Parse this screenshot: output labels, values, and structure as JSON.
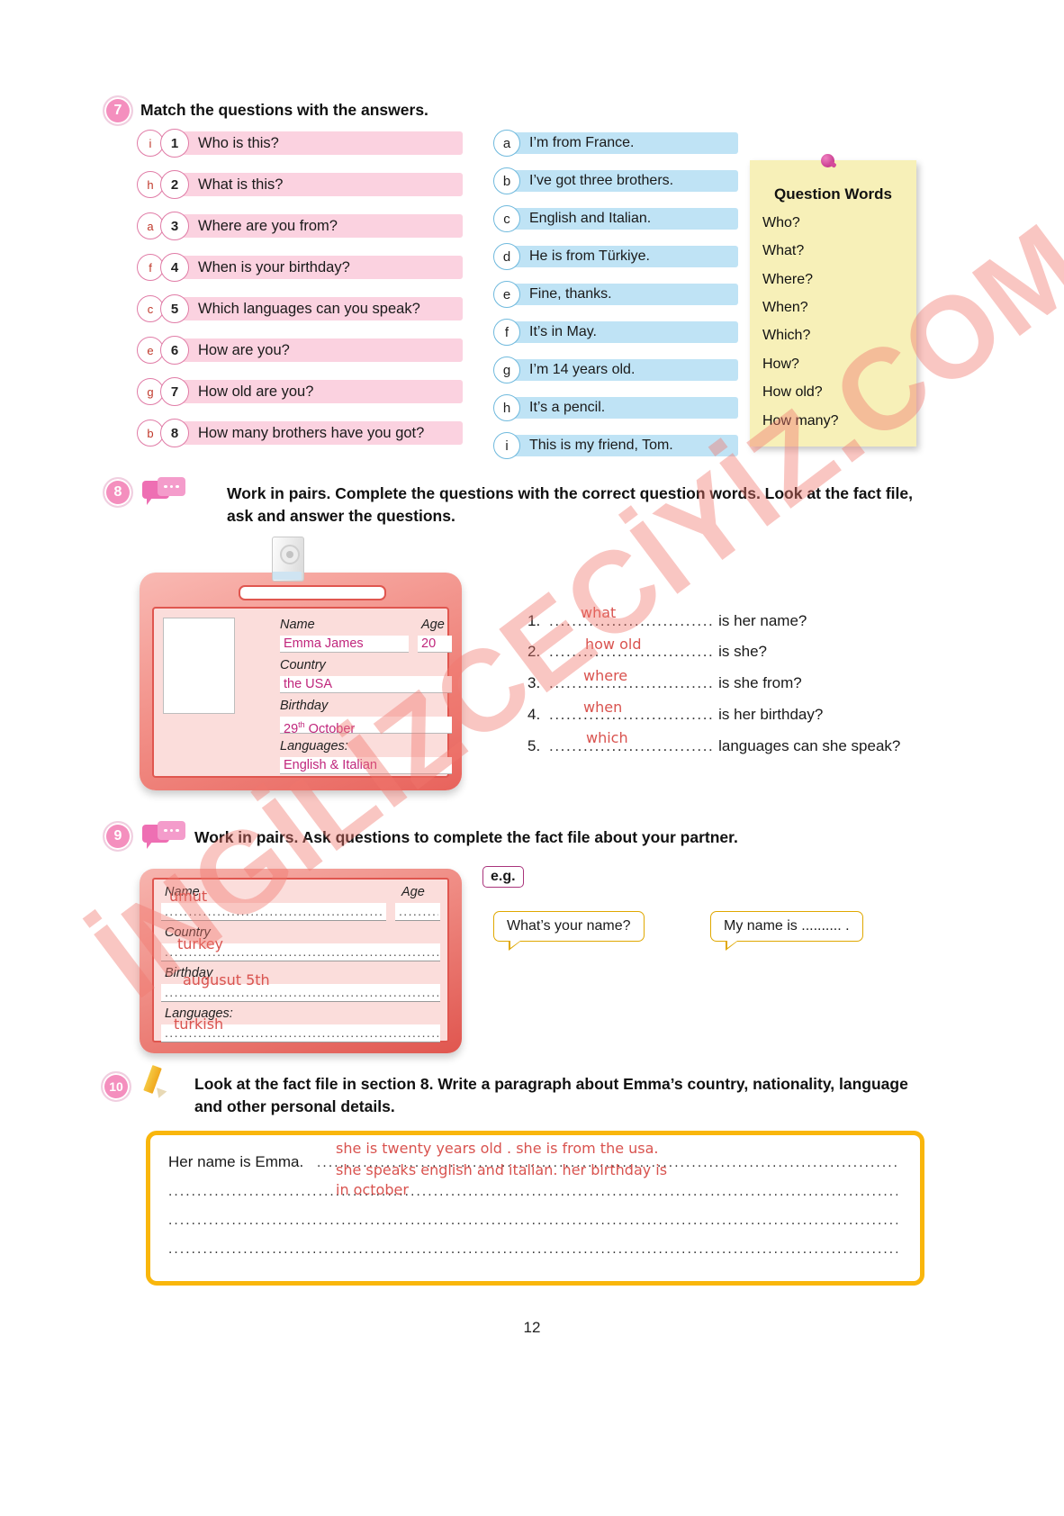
{
  "watermark": "İNGİLİZCECİYİZ.COM",
  "page_number": "12",
  "exercise7": {
    "number": "7",
    "instruction": "Match the questions with the answers.",
    "questions": [
      {
        "answer": "i",
        "num": "1",
        "text": "Who is this?"
      },
      {
        "answer": "h",
        "num": "2",
        "text": "What is this?"
      },
      {
        "answer": "a",
        "num": "3",
        "text": "Where are you from?"
      },
      {
        "answer": "f",
        "num": "4",
        "text": "When is your birthday?"
      },
      {
        "answer": "c",
        "num": "5",
        "text": "Which languages can you speak?"
      },
      {
        "answer": "e",
        "num": "6",
        "text": "How are you?"
      },
      {
        "answer": "g",
        "num": "7",
        "text": "How old are you?"
      },
      {
        "answer": "b",
        "num": "8",
        "text": "How many brothers have you got?"
      }
    ],
    "answers": [
      {
        "letter": "a",
        "text": "I’m from France."
      },
      {
        "letter": "b",
        "text": "I’ve got three brothers."
      },
      {
        "letter": "c",
        "text": "English and Italian."
      },
      {
        "letter": "d",
        "text": "He is from Türkiye."
      },
      {
        "letter": "e",
        "text": "Fine, thanks."
      },
      {
        "letter": "f",
        "text": "It’s in May."
      },
      {
        "letter": "g",
        "text": "I’m 14 years old."
      },
      {
        "letter": "h",
        "text": "It’s a pencil."
      },
      {
        "letter": "i",
        "text": "This is my friend, Tom."
      }
    ],
    "sticky": {
      "title": "Question Words",
      "words": [
        "Who?",
        "What?",
        "Where?",
        "When?",
        "Which?",
        "How?",
        "How old?",
        "How many?"
      ]
    }
  },
  "exercise8": {
    "number": "8",
    "instruction": "Work in pairs. Complete the questions with the correct question words. Look at the fact file, ask and answer the questions.",
    "factfile": {
      "name_label": "Name",
      "name_value": "Emma James",
      "age_label": "Age",
      "age_value": "20",
      "country_label": "Country",
      "country_value": "the USA",
      "birthday_label": "Birthday",
      "birthday_value": "29",
      "birthday_sup": "th",
      "birthday_rest": " October",
      "languages_label": "Languages:",
      "languages_value": "English & Italian"
    },
    "items": [
      {
        "num": "1.",
        "answer": "what",
        "tail": "is her name?"
      },
      {
        "num": "2.",
        "answer": "how old",
        "tail": "is she?"
      },
      {
        "num": "3.",
        "answer": "where",
        "tail": "is she from?"
      },
      {
        "num": "4.",
        "answer": "when",
        "tail": "is her birthday?"
      },
      {
        "num": "5.",
        "answer": "which",
        "tail": "languages can she speak?"
      }
    ],
    "blank_dots": "............................."
  },
  "exercise9": {
    "number": "9",
    "instruction": "Work in pairs. Ask questions to complete the fact file about your partner.",
    "factfile": {
      "name_label": "Name",
      "age_label": "Age",
      "country_label": "Country",
      "birthday_label": "Birthday",
      "languages_label": "Languages:",
      "name_value": "umut",
      "country_value": "turkey",
      "birthday_value": "augusut 5th",
      "languages_value": "turkish",
      "dots_long": "...................................................................",
      "dots_short": "........."
    },
    "eg_label": "e.g.",
    "bubble_left": "What’s your name?",
    "bubble_right": "My name is .......... ."
  },
  "exercise10": {
    "number": "10",
    "instruction": "Look at the fact file in section 8. Write a paragraph about Emma’s country, nationality, language and other personal details.",
    "starter": "Her name is Emma.",
    "handwriting": [
      "she is twenty years old . she is from the usa.",
      "she speaks english and italian. her birthday is",
      "in october"
    ],
    "dot_line": "............................................................................................................................................."
  }
}
